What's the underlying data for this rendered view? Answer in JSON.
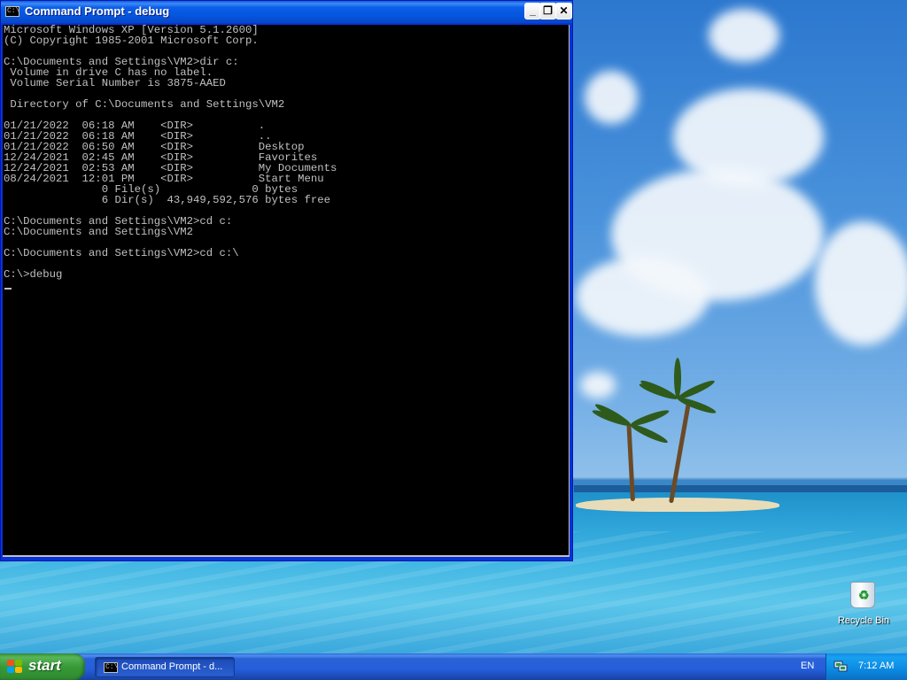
{
  "window": {
    "title": "Command Prompt - debug",
    "icon_text": "C:\\",
    "controls": {
      "minimize": "_",
      "maximize": "❐",
      "close": "✕"
    }
  },
  "console": {
    "lines": [
      "Microsoft Windows XP [Version 5.1.2600]",
      "(C) Copyright 1985-2001 Microsoft Corp.",
      "",
      "C:\\Documents and Settings\\VM2>dir c:",
      " Volume in drive C has no label.",
      " Volume Serial Number is 3875-AAED",
      "",
      " Directory of C:\\Documents and Settings\\VM2",
      "",
      "01/21/2022  06:18 AM    <DIR>          .",
      "01/21/2022  06:18 AM    <DIR>          ..",
      "01/21/2022  06:50 AM    <DIR>          Desktop",
      "12/24/2021  02:45 AM    <DIR>          Favorites",
      "12/24/2021  02:53 AM    <DIR>          My Documents",
      "08/24/2021  12:01 PM    <DIR>          Start Menu",
      "               0 File(s)              0 bytes",
      "               6 Dir(s)  43,949,592,576 bytes free",
      "",
      "C:\\Documents and Settings\\VM2>cd c:",
      "C:\\Documents and Settings\\VM2",
      "",
      "C:\\Documents and Settings\\VM2>cd c:\\",
      "",
      "C:\\>debug"
    ]
  },
  "desktop": {
    "recycle_bin_label": "Recycle Bin"
  },
  "taskbar": {
    "start_label": "start",
    "task_button_label": "Command Prompt - d...",
    "language": "EN",
    "clock": "7:12 AM"
  },
  "colors": {
    "console_bg": "#000000",
    "console_fg": "#c0c0c0",
    "titlebar": "#0a5fe8",
    "start_green": "#379a37",
    "taskbar_blue": "#245edb"
  }
}
